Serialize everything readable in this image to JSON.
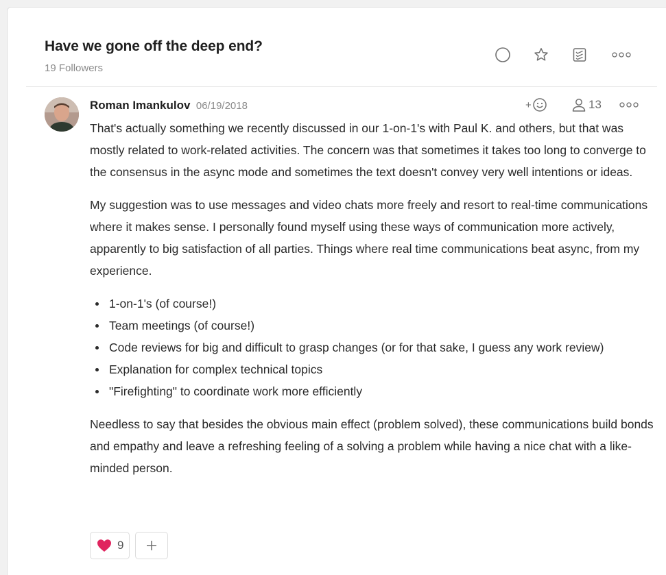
{
  "thread": {
    "title": "Have we gone off the deep end?",
    "followers": "19 Followers"
  },
  "header_actions": [
    "complete-circle-icon",
    "star-icon",
    "checklist-icon",
    "more-dots-icon"
  ],
  "comment": {
    "author": "Roman Imankulov",
    "date": "06/19/2018",
    "actions": {
      "add_reaction_label": "+",
      "participants_count": "13"
    },
    "paragraphs": [
      "That's actually something we recently discussed in our 1-on-1's with Paul K. and others, but that was mostly related to work-related activities. The concern was that sometimes it takes too long to converge to the consensus in the async mode and sometimes the text doesn't convey very well intentions or ideas.",
      "My suggestion was to use messages and video chats more freely and resort to real-time communications where it makes sense. I personally found myself using these ways of communication more actively, apparently to big satisfaction of all parties. Things where real time communications beat async, from my experience."
    ],
    "bullets": [
      "1-on-1's (of course!)",
      "Team meetings (of course!)",
      "Code reviews for big and difficult to grasp changes (or for that sake, I guess any work review)",
      "Explanation for complex technical topics",
      "\"Firefighting\" to coordinate work more efficiently"
    ],
    "closing": "Needless to say that besides the obvious main effect (problem solved), these communications build bonds and empathy and leave a refreshing feeling of a solving a problem while having a nice chat with a like-minded person.",
    "reactions": [
      {
        "icon": "heart-icon",
        "emoji": "❤️",
        "count": "9"
      }
    ],
    "add_reaction": "+"
  },
  "colors": {
    "title": "#1f1f1f",
    "muted": "#8a8a8a",
    "icon": "#6f6f6f",
    "heart": "#e0245e",
    "border": "#dcdcdc"
  }
}
